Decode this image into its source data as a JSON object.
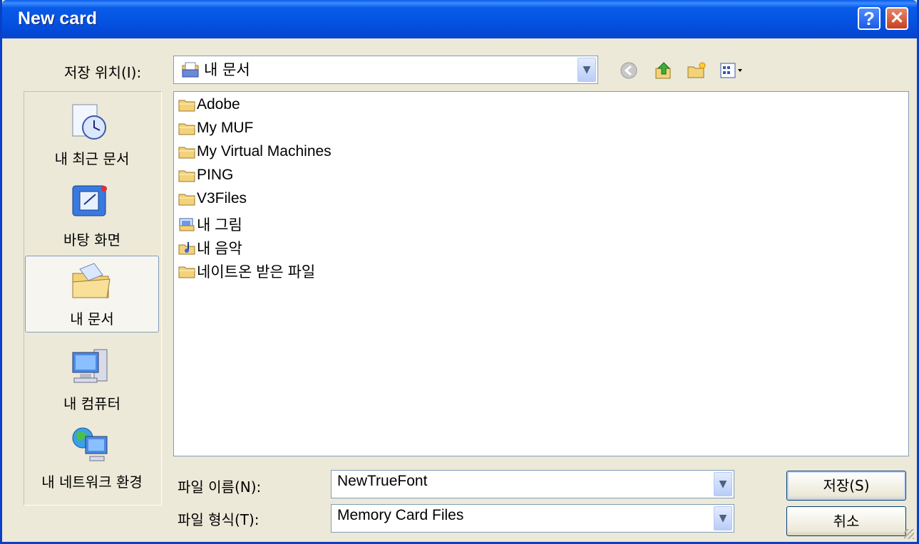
{
  "window": {
    "title": "New card",
    "help_label": "?",
    "close_label": "✕"
  },
  "location": {
    "label": "저장 위치(I):",
    "value": "내 문서"
  },
  "places": [
    {
      "name": "내 최근 문서",
      "icon": "recent-documents-icon"
    },
    {
      "name": "바탕 화면",
      "icon": "desktop-icon"
    },
    {
      "name": "내 문서",
      "icon": "my-documents-icon",
      "selected": true
    },
    {
      "name": "내 컴퓨터",
      "icon": "my-computer-icon"
    },
    {
      "name": "내 네트워크 환경",
      "icon": "network-icon"
    }
  ],
  "files": [
    {
      "name": "Adobe",
      "icon": "folder-icon"
    },
    {
      "name": "My MUF",
      "icon": "folder-icon"
    },
    {
      "name": "My Virtual Machines",
      "icon": "folder-icon"
    },
    {
      "name": "PING",
      "icon": "folder-icon"
    },
    {
      "name": "V3Files",
      "icon": "folder-icon"
    },
    {
      "name": "내 그림",
      "icon": "pictures-folder-icon"
    },
    {
      "name": "내 음악",
      "icon": "music-folder-icon"
    },
    {
      "name": "네이트온 받은 파일",
      "icon": "folder-icon"
    }
  ],
  "filename": {
    "label": "파일 이름(N):",
    "value": "NewTrueFont"
  },
  "filetype": {
    "label": "파일 형식(T):",
    "value": "Memory Card Files"
  },
  "buttons": {
    "save": "저장(S)",
    "cancel": "취소"
  },
  "colors": {
    "titlebar": "#0553e2",
    "dialog_bg": "#ece9d8",
    "folder": "#f4d27a"
  }
}
